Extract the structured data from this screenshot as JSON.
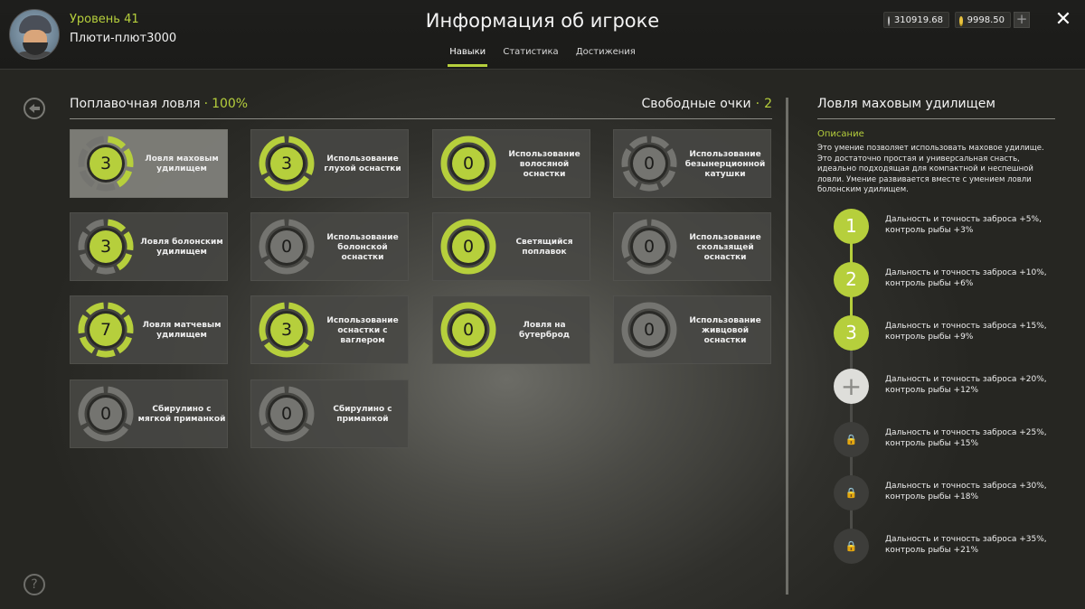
{
  "header": {
    "level": "Уровень 41",
    "username": "Плюти-плют3000",
    "title": "Информация об игроке",
    "tabs": [
      {
        "label": "Навыки",
        "active": true
      },
      {
        "label": "Статистика",
        "active": false
      },
      {
        "label": "Достижения",
        "active": false
      }
    ],
    "silver": "310919.68",
    "gold": "9998.50",
    "plus": "+",
    "close": "✕"
  },
  "colors": {
    "accent": "#b6cf3c",
    "ring_bg": "#747470",
    "inner": "#2a2a27"
  },
  "section": {
    "title": "Поплавочная ловля",
    "dot": "·",
    "percent": "100%",
    "free_points_label": "Свободные очки",
    "free_points": "2"
  },
  "skills": [
    {
      "label": "Ловля маховым удилищем",
      "value": "3",
      "filled": 3,
      "total": 7,
      "selected": true
    },
    {
      "label": "Использование глухой оснастки",
      "value": "3",
      "filled": 3,
      "total": 3,
      "selected": false
    },
    {
      "label": "Использование волосяной оснастки",
      "value": "0",
      "filled": 1,
      "total": 1,
      "selected": false
    },
    {
      "label": "Использование безынерционной катушки",
      "value": "0",
      "filled": 0,
      "total": 7,
      "selected": false
    },
    {
      "label": "Ловля болонским удилищем",
      "value": "3",
      "filled": 3,
      "total": 7,
      "selected": false
    },
    {
      "label": "Использование болонской оснастки",
      "value": "0",
      "filled": 0,
      "total": 3,
      "selected": false
    },
    {
      "label": "Светящийся поплавок",
      "value": "0",
      "filled": 1,
      "total": 1,
      "selected": false
    },
    {
      "label": "Использование скользящей оснастки",
      "value": "0",
      "filled": 0,
      "total": 3,
      "selected": false
    },
    {
      "label": "Ловля матчевым удилищем",
      "value": "7",
      "filled": 7,
      "total": 7,
      "selected": false
    },
    {
      "label": "Использование оснастки с ваглером",
      "value": "3",
      "filled": 3,
      "total": 3,
      "selected": false
    },
    {
      "label": "Ловля на бутерброд",
      "value": "0",
      "filled": 1,
      "total": 1,
      "selected": false
    },
    {
      "label": "Использование живцовой оснастки",
      "value": "0",
      "filled": 0,
      "total": 1,
      "selected": false
    },
    {
      "label": "Сбирулино с мягкой приманкой",
      "value": "0",
      "filled": 0,
      "total": 3,
      "selected": false
    },
    {
      "label": "Сбирулино с приманкой",
      "value": "0",
      "filled": 0,
      "total": 3,
      "selected": false
    }
  ],
  "detail": {
    "title": "Ловля маховым удилищем",
    "desc_label": "Описание",
    "desc": "Это умение позволяет использовать маховое удилище. Это достаточно простая и универсальная снасть, идеально подходящая для компактной и неспешной ловли. Умение развивается вместе с умением ловли болонским удилищем.",
    "levels": [
      {
        "state": "done",
        "mark": "1",
        "text": "Дальность и точность заброса +5%, контроль рыбы +3%"
      },
      {
        "state": "done",
        "mark": "2",
        "text": "Дальность и точность заброса +10%, контроль рыбы +6%"
      },
      {
        "state": "done",
        "mark": "3",
        "text": "Дальность и точность заброса +15%, контроль рыбы +9%"
      },
      {
        "state": "next",
        "mark": "+",
        "text": "Дальность и точность заброса +20%, контроль рыбы +12%"
      },
      {
        "state": "locked",
        "mark": "🔒",
        "text": "Дальность и точность заброса +25%, контроль рыбы +15%"
      },
      {
        "state": "locked",
        "mark": "🔒",
        "text": "Дальность и точность заброса +30%, контроль рыбы +18%"
      },
      {
        "state": "locked",
        "mark": "🔒",
        "text": "Дальность и точность заброса +35%, контроль рыбы +21%"
      }
    ]
  }
}
